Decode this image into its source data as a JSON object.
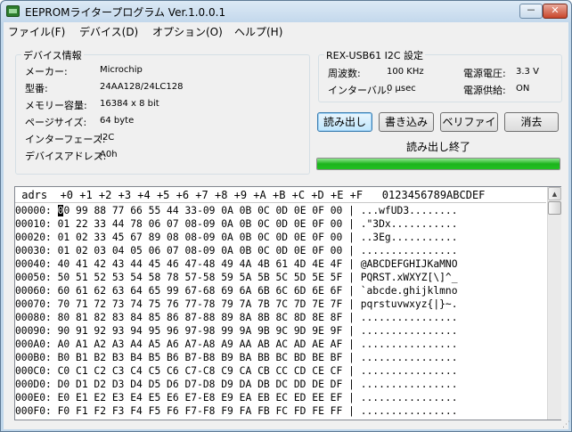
{
  "window": {
    "title": "EEPROMライタープログラム  Ver.1.0.0.1"
  },
  "titlebar_buttons": {
    "minimize": "－",
    "close": "✕"
  },
  "menu": [
    "ファイル(F)",
    "デバイス(D)",
    "オプション(O)",
    "ヘルプ(H)"
  ],
  "device": {
    "group_title": "デバイス情報",
    "rows": [
      {
        "label": "メーカー:",
        "value": "Microchip"
      },
      {
        "label": "型番:",
        "value": "24AA128/24LC128"
      },
      {
        "label": "メモリー容量:",
        "value": "16384 x 8 bit"
      },
      {
        "label": "ページサイズ:",
        "value": "64 byte"
      },
      {
        "label": "インターフェース:",
        "value": "I2C"
      },
      {
        "label": "デバイスアドレス:",
        "value": "A0h"
      }
    ]
  },
  "i2c": {
    "group_title": "REX-USB61 I2C 設定",
    "freq_label": "周波数:",
    "freq_value": "100 KHz",
    "interval_label": "インターバル:",
    "interval_value": "0 μsec",
    "voltage_label": "電源電圧:",
    "voltage_value": "3.3 V",
    "supply_label": "電源供給:",
    "supply_value": "ON"
  },
  "buttons": {
    "read": "読み出し",
    "write": "書き込み",
    "verify": "ベリファイ",
    "erase": "消去"
  },
  "status": {
    "text": "読み出し終了",
    "progress": 1.0,
    "progress_color": "#22bb22"
  },
  "hex": {
    "header": " adrs  +0 +1 +2 +3 +4 +5 +6 +7 +8 +9 +A +B +C +D +E +F   0123456789ABCDEF",
    "rows": [
      {
        "adrs": "00000:",
        "bytes": "00 99 88 77 66 55 44 33-09 0A 0B 0C 0D 0E 0F 00",
        "ascii": "...wfUD3........"
      },
      {
        "adrs": "00010:",
        "bytes": "01 22 33 44 78 06 07 08-09 0A 0B 0C 0D 0E 0F 00",
        "ascii": ".\"3Dx..........."
      },
      {
        "adrs": "00020:",
        "bytes": "01 02 33 45 67 89 08 08-09 0A 0B 0C 0D 0E 0F 00",
        "ascii": "..3Eg..........."
      },
      {
        "adrs": "00030:",
        "bytes": "01 02 03 04 05 06 07 08-09 0A 0B 0C 0D 0E 0F 00",
        "ascii": "................"
      },
      {
        "adrs": "00040:",
        "bytes": "40 41 42 43 44 45 46 47-48 49 4A 4B 61 4D 4E 4F",
        "ascii": "@ABCDEFGHIJKaMNO"
      },
      {
        "adrs": "00050:",
        "bytes": "50 51 52 53 54 58 78 57-58 59 5A 5B 5C 5D 5E 5F",
        "ascii": "PQRST.xWXYZ[\\]^_"
      },
      {
        "adrs": "00060:",
        "bytes": "60 61 62 63 64 65 99 67-68 69 6A 6B 6C 6D 6E 6F",
        "ascii": "`abcde.ghijklmno"
      },
      {
        "adrs": "00070:",
        "bytes": "70 71 72 73 74 75 76 77-78 79 7A 7B 7C 7D 7E 7F",
        "ascii": "pqrstuvwxyz{|}~."
      },
      {
        "adrs": "00080:",
        "bytes": "80 81 82 83 84 85 86 87-88 89 8A 8B 8C 8D 8E 8F",
        "ascii": "................"
      },
      {
        "adrs": "00090:",
        "bytes": "90 91 92 93 94 95 96 97-98 99 9A 9B 9C 9D 9E 9F",
        "ascii": "................"
      },
      {
        "adrs": "000A0:",
        "bytes": "A0 A1 A2 A3 A4 A5 A6 A7-A8 A9 AA AB AC AD AE AF",
        "ascii": "................"
      },
      {
        "adrs": "000B0:",
        "bytes": "B0 B1 B2 B3 B4 B5 B6 B7-B8 B9 BA BB BC BD BE BF",
        "ascii": "................"
      },
      {
        "adrs": "000C0:",
        "bytes": "C0 C1 C2 C3 C4 C5 C6 C7-C8 C9 CA CB CC CD CE CF",
        "ascii": "................"
      },
      {
        "adrs": "000D0:",
        "bytes": "D0 D1 D2 D3 D4 D5 D6 D7-D8 D9 DA DB DC DD DE DF",
        "ascii": "................"
      },
      {
        "adrs": "000E0:",
        "bytes": "E0 E1 E2 E3 E4 E5 E6 E7-E8 E9 EA EB EC ED EE EF",
        "ascii": "................"
      },
      {
        "adrs": "000F0:",
        "bytes": "F0 F1 F2 F3 F4 F5 F6 F7-F8 F9 FA FB FC FD FE FF",
        "ascii": "................"
      }
    ]
  }
}
